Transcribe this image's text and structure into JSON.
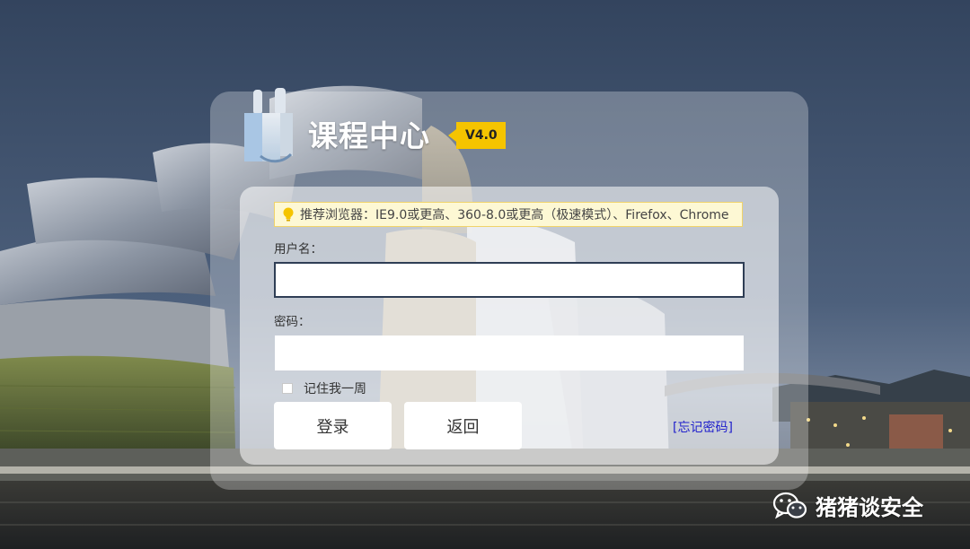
{
  "app": {
    "title": "课程中心",
    "version": "V4.0"
  },
  "notice": {
    "icon": "lightbulb-icon",
    "text": "推荐浏览器：IE9.0或更高、360-8.0或更高（极速模式）、Firefox、Chrome"
  },
  "form": {
    "username_label": "用户名：",
    "username_value": "",
    "password_label": "密码：",
    "password_value": "",
    "remember_label": "记住我一周",
    "remember_checked": false,
    "login_button": "登录",
    "back_button": "返回",
    "forgot_link": "[忘记密码]"
  },
  "watermark": {
    "icon": "wechat-icon",
    "text": "猪猪谈安全"
  },
  "colors": {
    "accent": "#f5c400",
    "link": "#2222cc",
    "focus_border": "#2f3e55"
  }
}
